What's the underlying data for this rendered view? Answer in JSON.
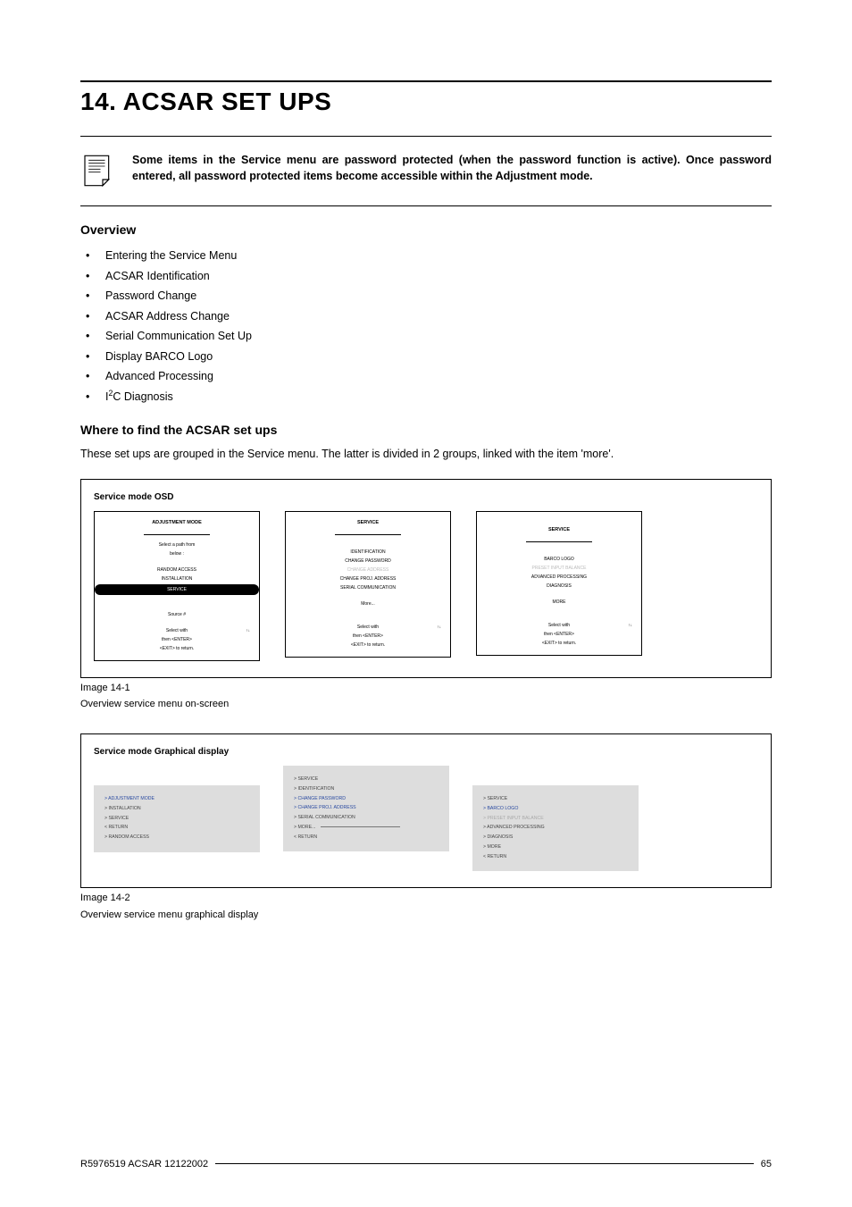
{
  "title": "14. ACSAR SET UPS",
  "note": "Some items in the Service menu are password protected (when the password function is active). Once password entered, all password protected items become accessible within the Adjustment mode.",
  "overview": {
    "heading": "Overview",
    "items": [
      "Entering the Service Menu",
      "ACSAR Identification",
      "Password Change",
      "ACSAR Address Change",
      "Serial Communication Set Up",
      "Display BARCO Logo",
      "Advanced Processing"
    ],
    "7a": "I",
    "7sup": "2",
    "7b": "C Diagnosis"
  },
  "where": {
    "heading": "Where to find the ACSAR set ups",
    "body": "These set ups are grouped in the Service menu. The latter is divided in 2 groups, linked with the item 'more'."
  },
  "fig1": {
    "title": "Service mode OSD",
    "common": {
      "arrows": "↑↓"
    },
    "p1": {
      "header": "ADJUSTMENT MODE",
      "i0": "Select a path from",
      "i1": "below :",
      "i2": "RANDOM ACCESS",
      "i3": "INSTALLATION",
      "i4": "SERVICE",
      "f0": "Source #",
      "f1": "Select with",
      "f2": "then <ENTER>",
      "f3": "<EXIT> to return."
    },
    "p2": {
      "header": "SERVICE",
      "i0": "IDENTIFICATION",
      "i1": "CHANGE PASSWORD",
      "i2": "CHANGE ADDRESS",
      "i3": "CHANGE PROJ. ADDRESS",
      "i4": "SERIAL COMMUNICATION",
      "i5": "More...",
      "f0": "Select with",
      "f1": "then <ENTER>",
      "f2": "<EXIT> to return."
    },
    "p3": {
      "header": "SERVICE",
      "i0": "BARCO LOGO",
      "i1": "PRESET INPUT BALANCE",
      "i2": "ADVANCED PROCESSING",
      "i3": "DIAGNOSIS",
      "i4": "MORE",
      "f0": "Select with",
      "f1": "then <ENTER>",
      "f2": "<EXIT> to return."
    },
    "caption_a": "Image 14-1",
    "caption_b": "Overview service menu on-screen"
  },
  "fig2": {
    "title": "Service mode Graphical display",
    "p1": {
      "i0": "> ADJUSTMENT MODE",
      "i1": "> INSTALLATION",
      "i2": "> SERVICE",
      "i3": "   < RETURN",
      "i4": "> RANDOM ACCESS"
    },
    "p2": {
      "i0": "> SERVICE",
      "i1": "> IDENTIFICATION",
      "i2": "> CHANGE PASSWORD",
      "i3": "> CHANGE PROJ. ADDRESS",
      "i4": "> SERIAL COMMUNICATION",
      "i5": "> MORE...",
      "i6": "   < RETURN"
    },
    "p3": {
      "i0": "> SERVICE",
      "i1": "> BARCO LOGO",
      "i2": "> PRESET INPUT BALANCE",
      "i3": "> ADVANCED PROCESSING",
      "i4": "> DIAGNOSIS",
      "i5": "> MORE",
      "i6": "   < RETURN"
    },
    "caption_a": "Image 14-2",
    "caption_b": "Overview service menu graphical display"
  },
  "footer": {
    "left": "R5976519  ACSAR  12122002",
    "right": "65"
  }
}
